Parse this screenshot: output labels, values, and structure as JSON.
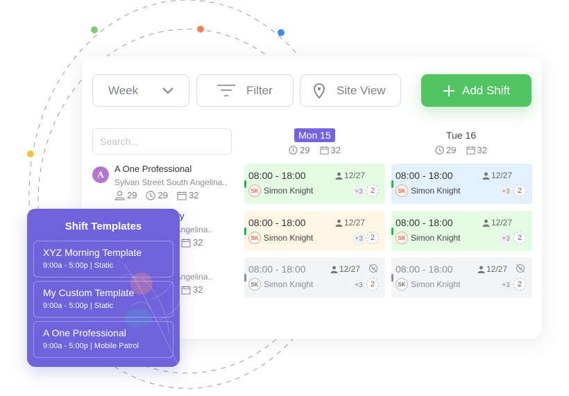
{
  "toolbar": {
    "view_select": "Week",
    "filter_label": "Filter",
    "site_view_label": "Site View",
    "add_shift_label": "Add Shift"
  },
  "search": {
    "placeholder": "Search..."
  },
  "sites": [
    {
      "initial": "A",
      "name": "A One Professional",
      "address": "Sylvan Street South Angelina..",
      "guards": "29",
      "hours": "29",
      "shifts": "32"
    },
    {
      "name": "…urity",
      "address": "…th Angelina..",
      "shifts": "32"
    },
    {
      "address": "…th Angelina..",
      "shifts": "32"
    }
  ],
  "days": [
    {
      "label": "Mon 15",
      "active": true,
      "hours": "29",
      "shifts": "32"
    },
    {
      "label": "Tue 16",
      "active": false,
      "hours": "29",
      "shifts": "32"
    }
  ],
  "shifts": [
    [
      {
        "time": "08:00 - 18:00",
        "count": "12/27",
        "initials": "SK",
        "employee": "Simon Knight",
        "more": "+3",
        "extra": "2",
        "status": "published"
      },
      {
        "time": "08:00 - 18:00",
        "count": "12/27",
        "initials": "SK",
        "employee": "Simon Knight",
        "more": "+3",
        "extra": "2",
        "status": "pending"
      },
      {
        "time": "08:00 - 18:00",
        "count": "12/27",
        "initials": "SK",
        "employee": "Simon Knight",
        "more": "+3",
        "extra": "2",
        "status": "hidden"
      }
    ],
    [
      {
        "time": "08:00 - 18:00",
        "count": "12/27",
        "initials": "SK",
        "employee": "Simon Knight",
        "more": "+3",
        "extra": "2",
        "status": "info"
      },
      {
        "time": "08:00 - 18:00",
        "count": "12/27",
        "initials": "SK",
        "employee": "Simon Knight",
        "more": "+3",
        "extra": "2",
        "status": "published"
      },
      {
        "time": "08:00 - 18:00",
        "count": "12/27",
        "initials": "SK",
        "employee": "Simon Knight",
        "more": "+3",
        "extra": "2",
        "status": "hidden"
      }
    ]
  ],
  "templates": {
    "title": "Shift Templates",
    "items": [
      {
        "name": "XYZ Morning Template",
        "detail": "9:00a - 5:00p | Static"
      },
      {
        "name": "My Custom Template",
        "detail": "9:00a - 5:00p | Static"
      },
      {
        "name": "A One Professional",
        "detail": "9:00a - 5:00p | Mobile Patrol"
      }
    ]
  },
  "colors": {
    "accent_purple": "#7564e0",
    "add_green": "#52c463",
    "shift_green_bg": "#e3fce3",
    "shift_blue_bg": "#e2f1fd",
    "shift_yellow_bg": "#fdf6e4",
    "shift_gray_bg": "#f3f4f6",
    "status_bar_green": "#1dbb4a",
    "status_bar_gray": "#8a8d94",
    "avatar_purple": "#b577c9",
    "dot_green": "#82c77a",
    "dot_orange": "#f0825c",
    "dot_blue": "#3d8ee8",
    "dot_yellow": "#f3c03c"
  }
}
